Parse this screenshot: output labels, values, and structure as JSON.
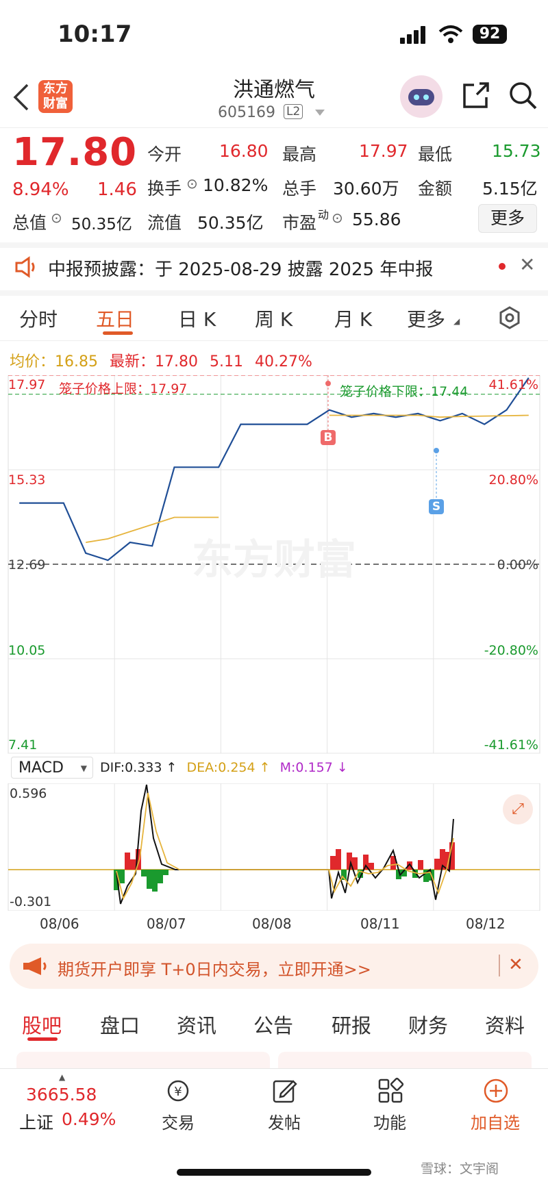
{
  "status": {
    "time": "10:17",
    "battery": "92"
  },
  "header": {
    "name": "洪通燃气",
    "code": "605169",
    "level": "L2",
    "logo": "东方财富"
  },
  "quote": {
    "price": "17.80",
    "change_pct": "8.94%",
    "change": "1.46",
    "open_label": "今开",
    "open": "16.80",
    "high_label": "最高",
    "high": "17.97",
    "low_label": "最低",
    "low": "15.73",
    "turnover_label": "换手",
    "turnover": "10.82%",
    "volume_label": "总手",
    "volume": "30.60万",
    "amount_label": "金额",
    "amount": "5.15亿",
    "mktcap_label": "总值",
    "mktcap": "50.35亿",
    "float_label": "流值",
    "float": "50.35亿",
    "pe_label": "市盈",
    "pe_sup": "动",
    "pe": "55.86",
    "more": "更多"
  },
  "notice": {
    "text": "中报预披露：于 2025-08-29 披露 2025 年中报"
  },
  "tabs": [
    "分时",
    "五日",
    "日 K",
    "周 K",
    "月 K",
    "更多"
  ],
  "chart_info": {
    "avg_label": "均价：",
    "avg": "16.85",
    "latest_label": "最新：",
    "latest": "17.80",
    "chg": "5.11",
    "pct": "40.27%"
  },
  "chart_data": {
    "type": "line",
    "x_labels": [
      "08/06",
      "08/07",
      "08/08",
      "08/11",
      "08/12"
    ],
    "y_left_ticks": [
      "17.97",
      "15.33",
      "12.69",
      "10.05",
      "7.41"
    ],
    "y_right_ticks": [
      "41.61%",
      "20.80%",
      "0.00%",
      "-20.80%",
      "-41.61%"
    ],
    "ylim": [
      7.41,
      17.97
    ],
    "prev_close": 12.69,
    "cage_upper": "笼子价格上限：17.97",
    "cage_lower": "笼子价格下限：17.44",
    "markers": {
      "buy": "B",
      "sell": "S"
    },
    "series": [
      {
        "name": "price",
        "color": "#1f4e96",
        "values": [
          14.4,
          14.4,
          14.4,
          13.0,
          12.8,
          13.3,
          13.2,
          15.4,
          15.4,
          15.4,
          16.6,
          16.6,
          16.6,
          16.6,
          17.0,
          16.8,
          16.9,
          16.8,
          16.9,
          16.7,
          16.9,
          16.6,
          17.0,
          17.9
        ]
      },
      {
        "name": "avg",
        "color": "#e6b43c",
        "values": [
          null,
          null,
          null,
          13.3,
          13.4,
          13.6,
          13.8,
          14.0,
          14.0,
          14.0,
          null,
          null,
          null,
          null,
          16.85,
          16.85,
          16.85,
          16.85,
          16.85,
          16.8,
          16.82,
          16.83,
          16.84,
          16.85
        ]
      }
    ]
  },
  "macd": {
    "label": "MACD",
    "dif": "DIF:0.333",
    "dea": "DEA:0.254",
    "m": "M:0.157",
    "y_top": "0.596",
    "y_bottom": "-0.301"
  },
  "banner": {
    "text": "期货开户即享 T+0日内交易，立即开通>>"
  },
  "subtabs": [
    "股吧",
    "盘口",
    "资讯",
    "公告",
    "研报",
    "财务",
    "资料"
  ],
  "bottom": {
    "index_value": "3665.58",
    "index_name": "上证",
    "index_pct": "0.49%",
    "trade": "交易",
    "post": "发帖",
    "func": "功能",
    "add": "加自选"
  },
  "watermark": "雪球：文宇阁",
  "colors": {
    "up": "#e0282c",
    "down": "#1a9a2e",
    "accent": "#e05a28",
    "line": "#1f4e96",
    "avg": "#e6b43c"
  }
}
